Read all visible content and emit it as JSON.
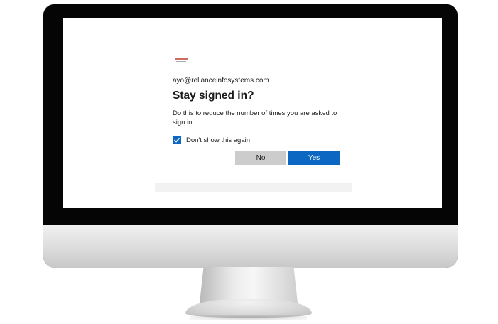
{
  "signin": {
    "email": "ayo@relianceinfosystems.com",
    "title": "Stay signed in?",
    "description": "Do this to reduce the number of times you are asked to sign in.",
    "checkbox_label": "Don't show this again",
    "checkbox_checked": true,
    "no_label": "No",
    "yes_label": "Yes"
  },
  "colors": {
    "accent": "#0b67c2",
    "secondary_button": "#cccccc",
    "monitor_bezel": "#050505"
  },
  "icons": {
    "logo": "company-logo",
    "checkbox": "checkmark-icon"
  }
}
